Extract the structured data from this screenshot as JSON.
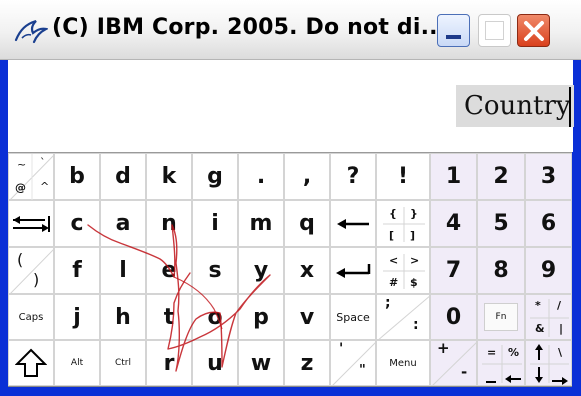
{
  "window": {
    "title": "(C) IBM Corp. 2005. Do not di..."
  },
  "editor": {
    "typed_word": "Country"
  },
  "keys": {
    "row1": {
      "tl_1": "~",
      "tl_2": "`",
      "tl_3": "@",
      "tl_4": "^",
      "b": "b",
      "d": "d",
      "k": "k",
      "g": "g",
      "dot": ".",
      "comma": ",",
      "question": "?",
      "exclaim": "!",
      "n1": "1",
      "n2": "2",
      "n3": "3"
    },
    "row2": {
      "c": "c",
      "a": "a",
      "n": "n",
      "i": "i",
      "m": "m",
      "q": "q",
      "br1": "{",
      "br2": "}",
      "br3": "[",
      "br4": "]",
      "n4": "4",
      "n5": "5",
      "n6": "6"
    },
    "row3": {
      "paren1": "(",
      "paren2": ")",
      "f": "f",
      "l": "l",
      "e": "e",
      "s": "s",
      "y": "y",
      "x": "x",
      "sym1": "<",
      "sym2": ">",
      "sym3": "#",
      "sym4": "$",
      "n7": "7",
      "n8": "8",
      "n9": "9"
    },
    "row4": {
      "caps": "Caps",
      "j": "j",
      "h": "h",
      "t": "t",
      "o": "o",
      "p": "p",
      "v": "v",
      "space": "Space",
      "semi": ";",
      "colon": ":",
      "n0": "0",
      "fn": "Fn",
      "star": "*",
      "slash": "/",
      "amp": "&",
      "pipe": "|"
    },
    "row5": {
      "alt": "Alt",
      "ctrl": "Ctrl",
      "r": "r",
      "u": "u",
      "w": "w",
      "z": "z",
      "apos": "'",
      "quote": "\"",
      "menu": "Menu",
      "plus": "+",
      "minus": "-",
      "equals": "=",
      "percent": "%",
      "backslash": "\\"
    }
  },
  "colors": {
    "titlebar_text": "#000000",
    "numpad": "#f1ecf8",
    "gesture_stroke": "#c0141a",
    "close_button": "#d9401d"
  }
}
